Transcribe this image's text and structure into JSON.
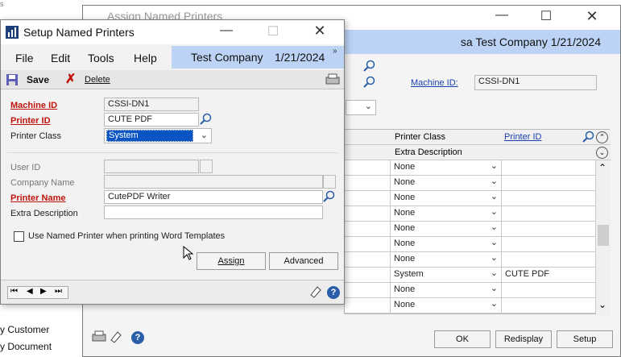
{
  "background_list": {
    "items": [
      "y Customer",
      "y Document"
    ]
  },
  "back_window": {
    "title": "Assign Named Printers",
    "header_right": "sa  Test Company  1/21/2024",
    "machine_id_label": "Machine ID:",
    "machine_id_value": "CSSI-DN1",
    "grid": {
      "col_printer_class": "Printer Class",
      "col_printer_id": "Printer ID",
      "extra_description": "Extra Description",
      "rows": [
        {
          "cls": "None",
          "id": ""
        },
        {
          "cls": "None",
          "id": ""
        },
        {
          "cls": "None",
          "id": ""
        },
        {
          "cls": "None",
          "id": ""
        },
        {
          "cls": "None",
          "id": ""
        },
        {
          "cls": "None",
          "id": ""
        },
        {
          "cls": "None",
          "id": ""
        },
        {
          "cls": "System",
          "id": "CUTE PDF"
        },
        {
          "cls": "None",
          "id": ""
        },
        {
          "cls": "None",
          "id": ""
        }
      ]
    },
    "buttons": {
      "ok": "OK",
      "redisplay": "Redisplay",
      "setup": "Setup"
    }
  },
  "front_window": {
    "title": "Setup Named Printers",
    "menu": [
      "File",
      "Edit",
      "Tools",
      "Help"
    ],
    "header_company": "Test Company",
    "header_date": "1/21/2024",
    "toolbar": {
      "save": "Save",
      "delete": "Delete"
    },
    "fields": {
      "machine_id_label": "Machine ID",
      "machine_id_value": "CSSI-DN1",
      "printer_id_label": "Printer ID",
      "printer_id_value": "CUTE PDF",
      "printer_class_label": "Printer Class",
      "printer_class_value": "System",
      "user_id_label": "User ID",
      "company_name_label": "Company Name",
      "printer_name_label": "Printer Name",
      "printer_name_value": "CutePDF Writer",
      "extra_description_label": "Extra Description"
    },
    "checkbox_label": "Use Named Printer when printing Word Templates",
    "buttons": {
      "assign": "Assign",
      "advanced": "Advanced"
    }
  },
  "colors": {
    "accent_blue": "#bcd3f5",
    "required_red": "#c0140e",
    "selection_blue": "#0a54c4"
  }
}
